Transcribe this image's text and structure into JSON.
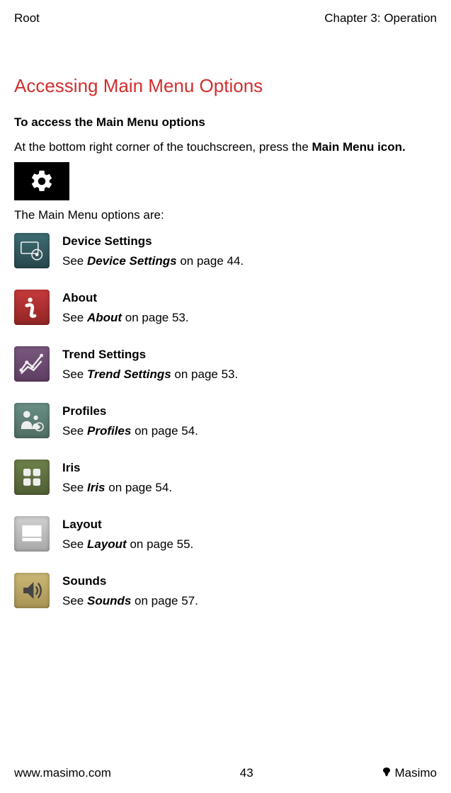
{
  "header": {
    "left": "Root",
    "right": "Chapter 3: Operation"
  },
  "section_title": "Accessing Main Menu Options",
  "sub_heading": "To access the Main Menu options",
  "intro_pre": "At the bottom right corner of the touchscreen, press the ",
  "intro_bold": "Main Menu icon.",
  "options_are": "The Main Menu options are:",
  "items": [
    {
      "title": "Device Settings",
      "see": "See ",
      "ref": "Device Settings",
      "tail": " on page 44.",
      "bg": "bg-teal",
      "icon": "device-settings-icon"
    },
    {
      "title": "About",
      "see": "See ",
      "ref": "About",
      "tail": " on page 53.",
      "bg": "bg-red",
      "icon": "info-icon"
    },
    {
      "title": "Trend Settings",
      "see": "See ",
      "ref": "Trend Settings",
      "tail": " on page 53.",
      "bg": "bg-purple",
      "icon": "trend-icon"
    },
    {
      "title": "Profiles",
      "see": "See ",
      "ref": "Profiles",
      "tail": " on page 54.",
      "bg": "bg-seafoam",
      "icon": "profiles-icon"
    },
    {
      "title": "Iris",
      "see": "See ",
      "ref": "Iris",
      "tail": " on page 54.",
      "bg": "bg-olive",
      "icon": "iris-icon"
    },
    {
      "title": "Layout",
      "see": "See ",
      "ref": "Layout",
      "tail": " on page 55.",
      "bg": "bg-gray",
      "icon": "layout-icon"
    },
    {
      "title": "Sounds",
      "see": "See ",
      "ref": "Sounds",
      "tail": " on page 57.",
      "bg": "bg-gold",
      "icon": "sounds-icon"
    }
  ],
  "footer": {
    "left": "www.masimo.com",
    "center": "43",
    "right": "Masimo"
  }
}
